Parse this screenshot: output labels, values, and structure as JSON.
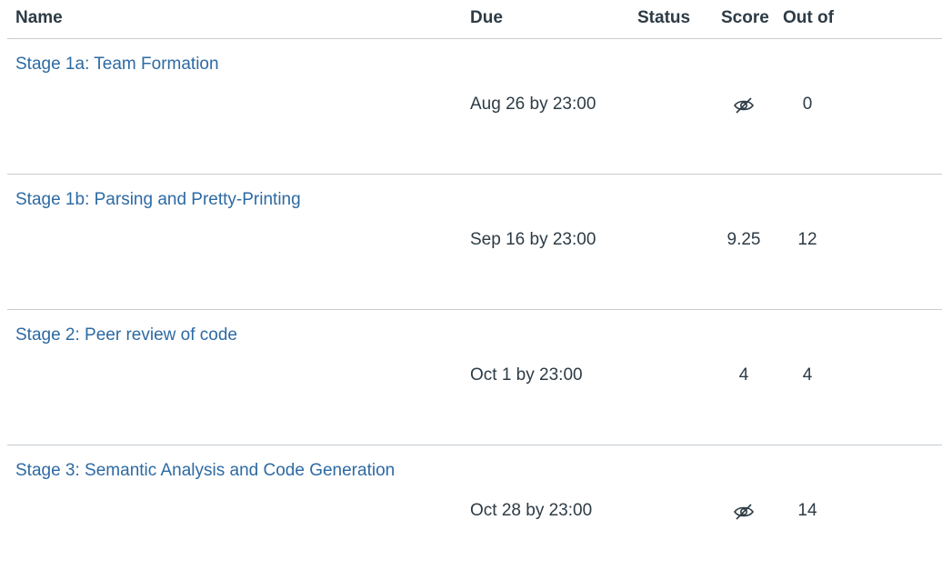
{
  "table": {
    "headers": {
      "name": "Name",
      "due": "Due",
      "status": "Status",
      "score": "Score",
      "out_of": "Out of"
    },
    "rows": [
      {
        "name": "Stage 1a: Team Formation",
        "due": "Aug 26 by 23:00",
        "status": "",
        "score": "",
        "score_icon": "hidden-eye-icon",
        "out_of": "0"
      },
      {
        "name": "Stage 1b: Parsing and Pretty-Printing",
        "due": "Sep 16 by 23:00",
        "status": "",
        "score": "9.25",
        "out_of": "12"
      },
      {
        "name": "Stage 2: Peer review of code",
        "due": "Oct 1 by 23:00",
        "status": "",
        "score": "4",
        "out_of": "4"
      },
      {
        "name": "Stage 3: Semantic Analysis and Code Generation",
        "due": "Oct 28 by 23:00",
        "status": "",
        "score": "",
        "score_icon": "hidden-eye-icon",
        "out_of": "14"
      }
    ]
  },
  "colors": {
    "link": "#2d6aa3",
    "text": "#2d3b45",
    "divider": "#c7cdd1"
  }
}
